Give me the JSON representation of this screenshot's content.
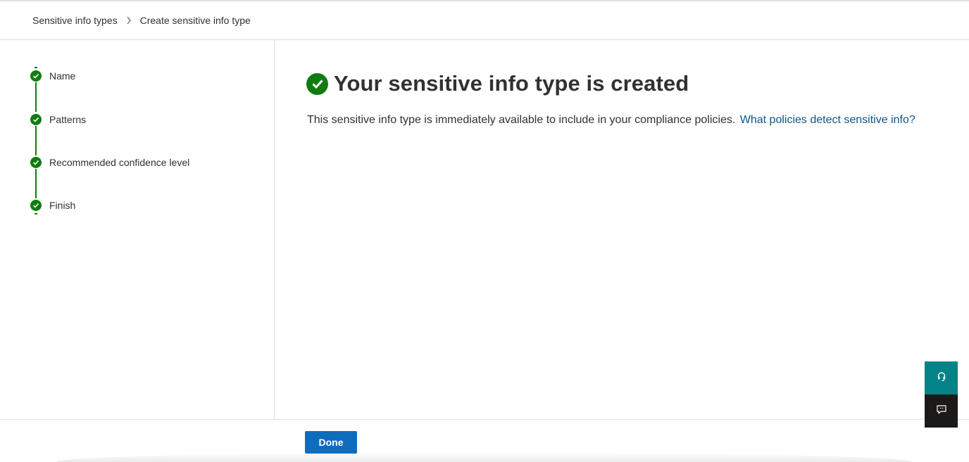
{
  "breadcrumb": {
    "items": [
      "Sensitive info types",
      "Create sensitive info type"
    ]
  },
  "steps": [
    {
      "label": "Name",
      "status": "completed"
    },
    {
      "label": "Patterns",
      "status": "completed"
    },
    {
      "label": "Recommended confidence level",
      "status": "completed"
    },
    {
      "label": "Finish",
      "status": "completed"
    }
  ],
  "main": {
    "title": "Your sensitive info type is created",
    "description": "This sensitive info type is immediately available to include in your compliance policies.",
    "link_text": "What policies detect sensitive info?"
  },
  "footer": {
    "done_label": "Done"
  },
  "side_buttons": {
    "help_icon": "headset-icon",
    "feedback_icon": "feedback-icon"
  },
  "colors": {
    "success": "#107c10",
    "primary": "#0f6cbd",
    "link": "#0f548c",
    "help_bg": "#038387",
    "feedback_bg": "#1b1a19"
  }
}
